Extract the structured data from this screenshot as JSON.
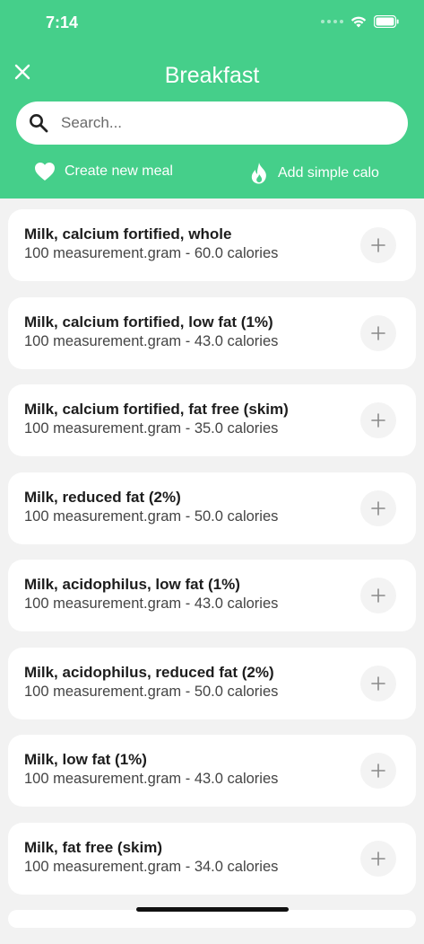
{
  "status_bar": {
    "time": "7:14"
  },
  "header": {
    "title": "Breakfast",
    "search_placeholder": "Search...",
    "create_meal_label": "Create new meal",
    "add_calories_label": "Add simple calo"
  },
  "colors": {
    "accent": "#45cf8a",
    "card": "#ffffff",
    "background": "#f2f2f2"
  },
  "foods": [
    {
      "name": "Milk, calcium fortified, whole",
      "detail": "100 measurement.gram - 60.0 calories"
    },
    {
      "name": "Milk, calcium fortified, low fat (1%)",
      "detail": "100 measurement.gram - 43.0 calories"
    },
    {
      "name": "Milk, calcium fortified, fat free (skim)",
      "detail": "100 measurement.gram - 35.0 calories"
    },
    {
      "name": "Milk, reduced fat (2%)",
      "detail": "100 measurement.gram - 50.0 calories"
    },
    {
      "name": "Milk, acidophilus, low fat (1%)",
      "detail": "100 measurement.gram - 43.0 calories"
    },
    {
      "name": "Milk, acidophilus, reduced fat (2%)",
      "detail": "100 measurement.gram - 50.0 calories"
    },
    {
      "name": "Milk, low fat (1%)",
      "detail": "100 measurement.gram - 43.0 calories"
    },
    {
      "name": "Milk, fat free (skim)",
      "detail": "100 measurement.gram - 34.0 calories"
    }
  ]
}
